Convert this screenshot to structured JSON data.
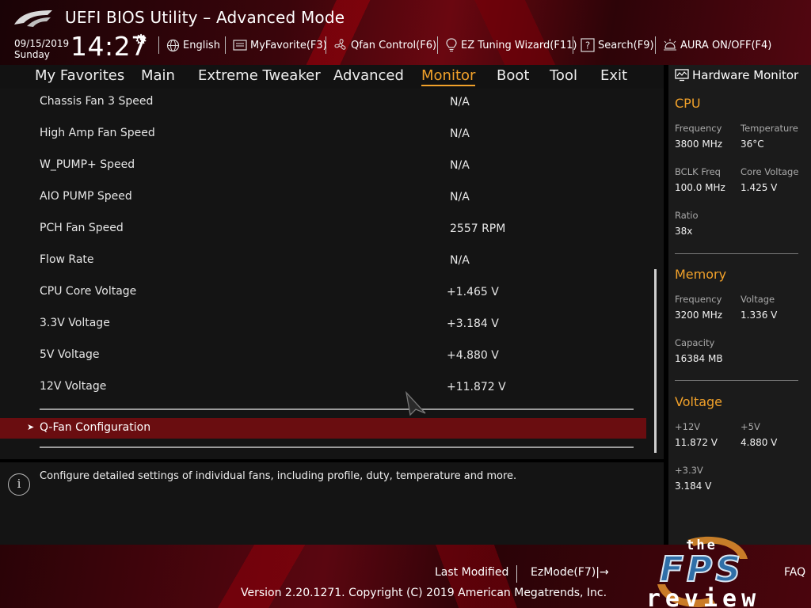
{
  "header": {
    "title": "UEFI BIOS Utility – Advanced Mode",
    "date": "09/15/2019",
    "day": "Sunday",
    "time": "14:27",
    "toolbar": [
      {
        "label": "English",
        "icon": "globe-icon"
      },
      {
        "label": "MyFavorite(F3)",
        "icon": "favorite-icon"
      },
      {
        "label": "Qfan Control(F6)",
        "icon": "fan-icon"
      },
      {
        "label": "EZ Tuning Wizard(F11)",
        "icon": "bulb-icon"
      },
      {
        "label": "Search(F9)",
        "icon": "help-search-icon"
      },
      {
        "label": "AURA ON/OFF(F4)",
        "icon": "aura-icon"
      }
    ]
  },
  "nav": {
    "tabs": [
      {
        "label": "My Favorites"
      },
      {
        "label": "Main"
      },
      {
        "label": "Extreme Tweaker"
      },
      {
        "label": "Advanced"
      },
      {
        "label": "Monitor",
        "active": true
      },
      {
        "label": "Boot"
      },
      {
        "label": "Tool"
      },
      {
        "label": "Exit"
      }
    ]
  },
  "monitor": {
    "rows": [
      {
        "label": "Chassis Fan 3 Speed",
        "value": "N/A"
      },
      {
        "label": "High Amp Fan Speed",
        "value": "N/A"
      },
      {
        "label": "W_PUMP+ Speed",
        "value": "N/A"
      },
      {
        "label": "AIO PUMP Speed",
        "value": "N/A"
      },
      {
        "label": "PCH Fan Speed",
        "value": "2557 RPM"
      },
      {
        "label": "Flow Rate",
        "value": "N/A"
      },
      {
        "label": "CPU Core Voltage",
        "value": "+1.465 V"
      },
      {
        "label": "3.3V Voltage",
        "value": "+3.184 V"
      },
      {
        "label": "5V Voltage",
        "value": "+4.880 V"
      },
      {
        "label": "12V Voltage",
        "value": "+11.872 V"
      }
    ],
    "submenu": "Q-Fan Configuration",
    "help": "Configure detailed settings of individual fans, including profile, duty, temperature and more."
  },
  "hw": {
    "title": "Hardware Monitor",
    "cpu": {
      "heading": "CPU",
      "frequency_label": "Frequency",
      "frequency": "3800 MHz",
      "temperature_label": "Temperature",
      "temperature": "36°C",
      "bclk_label": "BCLK Freq",
      "bclk": "100.0 MHz",
      "core_voltage_label": "Core Voltage",
      "core_voltage": "1.425 V",
      "ratio_label": "Ratio",
      "ratio": "38x"
    },
    "memory": {
      "heading": "Memory",
      "frequency_label": "Frequency",
      "frequency": "3200 MHz",
      "voltage_label": "Voltage",
      "voltage": "1.336 V",
      "capacity_label": "Capacity",
      "capacity": "16384 MB"
    },
    "voltage": {
      "heading": "Voltage",
      "v12_label": "+12V",
      "v12": "11.872 V",
      "v5_label": "+5V",
      "v5": "4.880 V",
      "v33_label": "+3.3V",
      "v33": "3.184 V"
    }
  },
  "footer": {
    "last_modified": "Last Modified",
    "ezmode": "EzMode(F7)|→",
    "faq": "FAQ",
    "version": "Version 2.20.1271. Copyright (C) 2019 American Megatrends, Inc."
  },
  "watermark": {
    "line1": "the",
    "line2": "FPS",
    "line3": "review"
  },
  "colors": {
    "accent": "#f1a12a",
    "selection": "#6a0d10",
    "header_red": "#6a0710"
  }
}
